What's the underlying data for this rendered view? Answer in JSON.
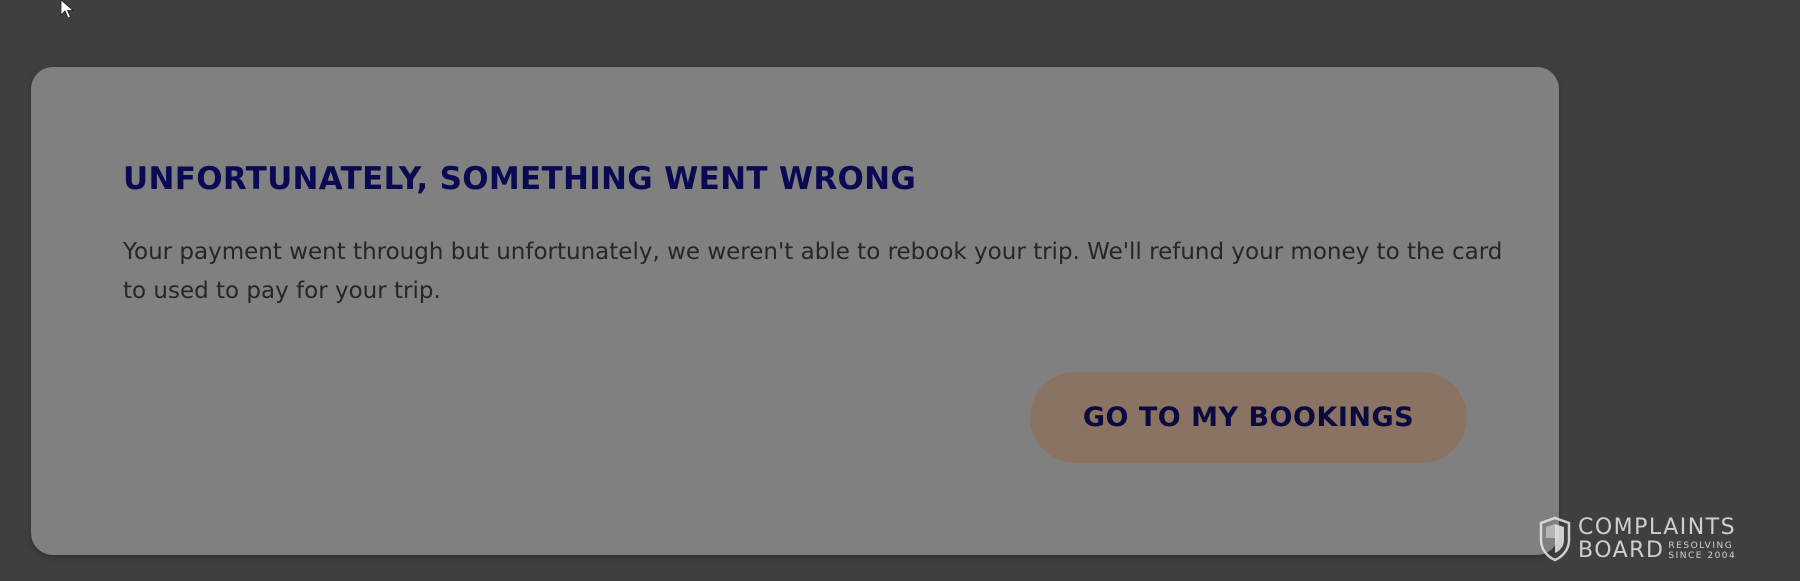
{
  "dialog": {
    "title": "UNFORTUNATELY, SOMETHING WENT WRONG",
    "message": "Your payment went through but unfortunately, we weren't able to rebook your trip. We'll refund your money to the card to used to pay for your trip.",
    "button_label": "GO TO MY BOOKINGS"
  },
  "watermark": {
    "line1": "COMPLAINTS",
    "line2": "BOARD",
    "tag_top": "RESOLVING",
    "tag_bottom": "SINCE 2004"
  },
  "icons": {
    "cursor": "mouse-pointer-icon",
    "watermark_logo": "shield-icon"
  },
  "colors": {
    "page_background": "#3f3f3f",
    "dialog_background": "#808080",
    "title": "#0a0a52",
    "button_background": "#8a7362",
    "button_text": "#0a0a3e"
  }
}
